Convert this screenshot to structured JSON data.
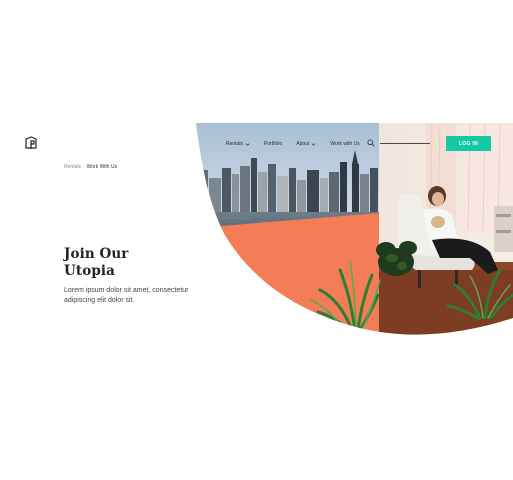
{
  "breadcrumb": {
    "parent": "Rentals",
    "separator": "·",
    "current": "Work With Us"
  },
  "hero": {
    "heading_line1": "Join Our",
    "heading_line2": "Utopia",
    "subtext": "Lorem ipsum dolor sit amet, consectetur adipiscing elit dolor sit."
  },
  "nav": {
    "items": [
      {
        "label": "Rentals",
        "has_dropdown": true
      },
      {
        "label": "Portfolio",
        "has_dropdown": false
      },
      {
        "label": "About",
        "has_dropdown": true
      },
      {
        "label": "Work with Us",
        "has_dropdown": false
      }
    ],
    "search_icon": "search-icon",
    "login_label": "LOG IN"
  },
  "colors": {
    "accent": "#13c9a6",
    "coral": "#f47c57",
    "text_dark": "#222222"
  }
}
